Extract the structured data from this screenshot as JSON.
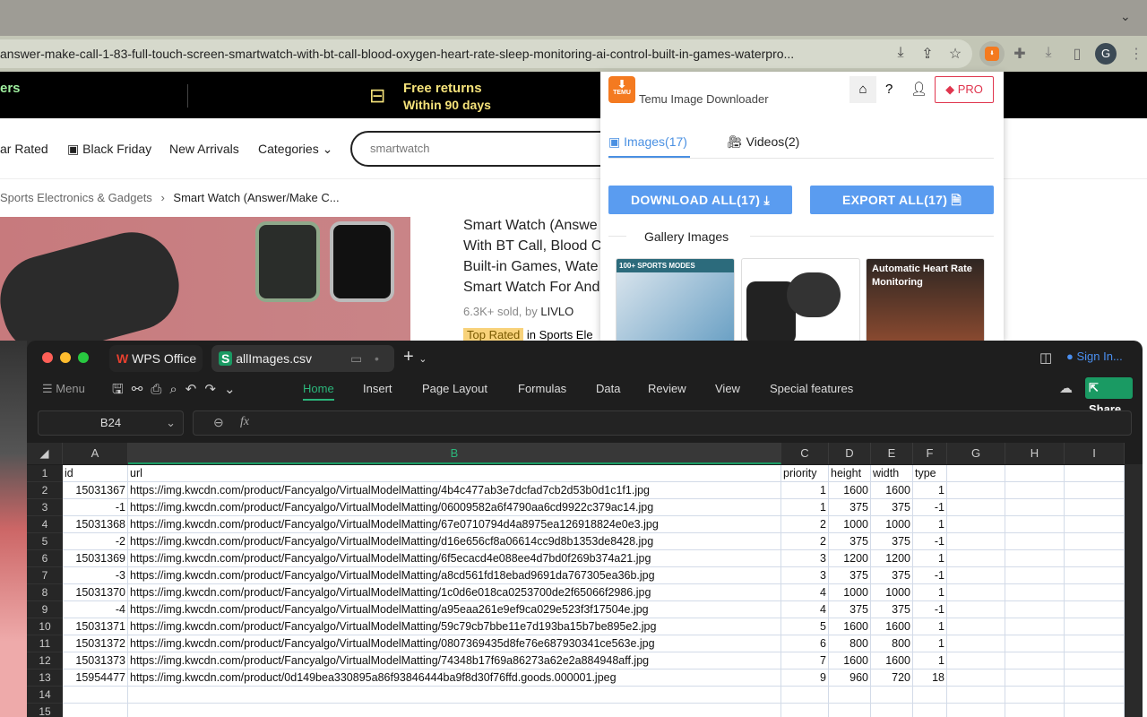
{
  "browser": {
    "url": "answer-make-call-1-83-full-touch-screen-smartwatch-with-bt-call-blood-oxygen-heart-rate-sleep-monitoring-ai-control-built-in-games-waterpro...",
    "profile_initial": "G"
  },
  "site": {
    "promo_left": "ers",
    "promo_title": "Free returns",
    "promo_sub": "Within 90 days",
    "nav": [
      "ar Rated",
      "Black Friday",
      "New Arrivals",
      "Categories"
    ],
    "search_value": "smartwatch",
    "breadcrumb": [
      "Sports Electronics & Gadgets",
      "Smart Watch (Answer/Make C..."
    ],
    "title_lines": [
      "Smart Watch (Answe",
      "With BT Call, Blood C",
      "Built-in Games, Wate",
      "Smart Watch For And"
    ],
    "sold": "6.3K+ sold, by",
    "seller": "LIVLO",
    "badge": "Top Rated",
    "badge_suffix": "in Sports Ele"
  },
  "popup": {
    "title": "Temu Image Downloader",
    "logo_text": "TEMU",
    "pro": "PRO",
    "help": "?",
    "tabs": [
      {
        "label": "Images(17)",
        "active": true
      },
      {
        "label": "Videos(2)"
      }
    ],
    "download_all": "DOWNLOAD ALL(17)",
    "export_all": "EXPORT ALL(17)",
    "section": "Gallery Images",
    "thumbs": [
      "100+ SPORTS MODES",
      "",
      "Automatic Heart Rate Monitoring"
    ]
  },
  "wps": {
    "tabs": [
      "WPS Office",
      "allImages.csv"
    ],
    "menu_label": "Menu",
    "ribbon": [
      "Home",
      "Insert",
      "Page Layout",
      "Formulas",
      "Data",
      "Review",
      "View",
      "Special features"
    ],
    "active_ribbon": "Home",
    "sign_in": "Sign In...",
    "share": "Share",
    "cell_ref": "B24",
    "fx": "fx",
    "columns": [
      "A",
      "B",
      "C",
      "D",
      "E",
      "F",
      "G",
      "H",
      "I"
    ],
    "selected_column": "B",
    "header": [
      "id",
      "url",
      "priority",
      "height",
      "width",
      "type"
    ],
    "rows": [
      [
        "15031367",
        "https://img.kwcdn.com/product/Fancyalgo/VirtualModelMatting/4b4c477ab3e7dcfad7cb2d53b0d1c1f1.jpg",
        "1",
        "1600",
        "1600",
        "1"
      ],
      [
        "-1",
        "https://img.kwcdn.com/product/Fancyalgo/VirtualModelMatting/06009582a6f4790aa6cd9922c379ac14.jpg",
        "1",
        "375",
        "375",
        "-1"
      ],
      [
        "15031368",
        "https://img.kwcdn.com/product/Fancyalgo/VirtualModelMatting/67e0710794d4a8975ea126918824e0e3.jpg",
        "2",
        "1000",
        "1000",
        "1"
      ],
      [
        "-2",
        "https://img.kwcdn.com/product/Fancyalgo/VirtualModelMatting/d16e656cf8a06614cc9d8b1353de8428.jpg",
        "2",
        "375",
        "375",
        "-1"
      ],
      [
        "15031369",
        "https://img.kwcdn.com/product/Fancyalgo/VirtualModelMatting/6f5ecacd4e088ee4d7bd0f269b374a21.jpg",
        "3",
        "1200",
        "1200",
        "1"
      ],
      [
        "-3",
        "https://img.kwcdn.com/product/Fancyalgo/VirtualModelMatting/a8cd561fd18ebad9691da767305ea36b.jpg",
        "3",
        "375",
        "375",
        "-1"
      ],
      [
        "15031370",
        "https://img.kwcdn.com/product/Fancyalgo/VirtualModelMatting/1c0d6e018ca0253700de2f65066f2986.jpg",
        "4",
        "1000",
        "1000",
        "1"
      ],
      [
        "-4",
        "https://img.kwcdn.com/product/Fancyalgo/VirtualModelMatting/a95eaa261e9ef9ca029e523f3f17504e.jpg",
        "4",
        "375",
        "375",
        "-1"
      ],
      [
        "15031371",
        "https://img.kwcdn.com/product/Fancyalgo/VirtualModelMatting/59c79cb7bbe11e7d193ba15b7be895e2.jpg",
        "5",
        "1600",
        "1600",
        "1"
      ],
      [
        "15031372",
        "https://img.kwcdn.com/product/Fancyalgo/VirtualModelMatting/0807369435d8fe76e687930341ce563e.jpg",
        "6",
        "800",
        "800",
        "1"
      ],
      [
        "15031373",
        "https://img.kwcdn.com/product/Fancyalgo/VirtualModelMatting/74348b17f69a86273a62e2a884948aff.jpg",
        "7",
        "1600",
        "1600",
        "1"
      ],
      [
        "15954477",
        "https://img.kwcdn.com/product/0d149bea330895a86f93846444ba9f8d30f76ffd.goods.000001.jpeg",
        "9",
        "960",
        "720",
        "18"
      ]
    ],
    "row_numbers": [
      "1",
      "2",
      "3",
      "4",
      "5",
      "6",
      "7",
      "8",
      "9",
      "10",
      "11",
      "12",
      "13",
      "14",
      "15"
    ]
  },
  "colors": {
    "accent_blue": "#5a9cf0",
    "temu_orange": "#f47a20",
    "wps_green": "#1a9a63",
    "pro_red": "#e0364f"
  }
}
